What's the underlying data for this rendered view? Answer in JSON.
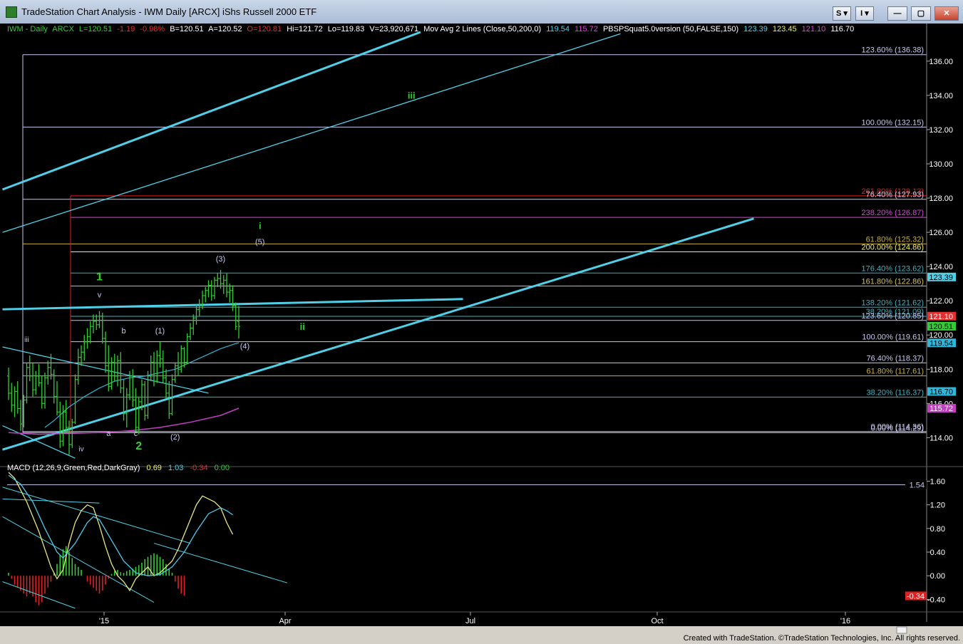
{
  "window": {
    "title": "TradeStation Chart Analysis - IWM Daily [ARCX] iShs Russell 2000 ETF",
    "btn_s": "S ▾",
    "btn_i": "I ▾"
  },
  "infobar": {
    "symbol": "IWM - Daily",
    "exchange": "ARCX",
    "last": "L=120.51",
    "change": "-1.19",
    "pct": "-0.98%",
    "bid": "B=120.51",
    "ask": "A=120.52",
    "open": "O=120.81",
    "high": "Hi=121.72",
    "low": "Lo=119.83",
    "volume": "V=23,920,671",
    "ma_label": "Mov Avg 2 Lines (Close,50,200,0)",
    "ma1": "119.54",
    "ma2": "115.72",
    "pbs_label": "PBSPSquat5.0version (50,FALSE,150)",
    "pbs1": "123.39",
    "pbs2": "123.45",
    "pbs3": "121.10",
    "pbs4": "116.70"
  },
  "macd_info": {
    "label": "MACD (12,26,9,Green,Red,DarkGray)",
    "v1": "0.69",
    "v2": "1.03",
    "v3": "-0.34",
    "v4": "0.00"
  },
  "status_text": "Created with TradeStation. ©TradeStation Technologies, Inc. All rights reserved.",
  "colors": {
    "bars": "#32cd32",
    "trend": "#4fd0e8",
    "ma_fast": "#2fb6d8",
    "ma_slow": "#c040c0",
    "macd_line": "#e8e880",
    "signal_line": "#4fc8e8",
    "hist_pos": "#32cd32",
    "hist_neg": "#e02020"
  },
  "chart_data": {
    "type": "candlestick",
    "price_axis": {
      "ylim": [
        112.6,
        137.7
      ],
      "ticks": [
        "114.00",
        "116.00",
        "118.00",
        "120.00",
        "122.00",
        "124.00",
        "126.00",
        "128.00",
        "130.00",
        "132.00",
        "134.00",
        "136.00"
      ]
    },
    "macd_axis": {
      "ylim": [
        -0.6,
        1.75
      ],
      "ticks": [
        "-0.40",
        "0.00",
        "0.40",
        "0.80",
        "1.20",
        "1.60"
      ]
    },
    "time_labels": [
      {
        "label": "'15",
        "x": 0
      },
      {
        "label": "Apr",
        "x": 76
      },
      {
        "label": "Jul",
        "x": 152
      },
      {
        "label": "Oct",
        "x": 230
      },
      {
        "label": "'16",
        "x": 307
      }
    ],
    "price_badges": [
      {
        "text": "123.39",
        "value": 123.39,
        "bg": "#4fd0e8",
        "fg": "#000000"
      },
      {
        "text": "121.10",
        "value": 121.1,
        "bg": "#e03030",
        "fg": "#ffffff"
      },
      {
        "text": "120.51",
        "value": 120.51,
        "bg": "#32cd32",
        "fg": "#000000"
      },
      {
        "text": "119.54",
        "value": 119.54,
        "bg": "#2fb6d8",
        "fg": "#000000"
      },
      {
        "text": "116.70",
        "value": 116.7,
        "bg": "#2fb6d8",
        "fg": "#000000"
      },
      {
        "text": "115.72",
        "value": 115.72,
        "bg": "#c040c0",
        "fg": "#ffffff"
      }
    ],
    "fib_levels": [
      {
        "label": "123.60% (136.38)",
        "value": 136.38,
        "color": "#c8c8f0"
      },
      {
        "label": "100.00% (132.15)",
        "value": 132.15,
        "color": "#c8c8f0"
      },
      {
        "label": "261.80% (128.13)",
        "value": 128.13,
        "color": "#e02020"
      },
      {
        "label": "76.40% (127.93)",
        "value": 127.93,
        "color": "#c8c8f0"
      },
      {
        "label": "238.20% (126.87)",
        "value": 126.87,
        "color": "#e040e0"
      },
      {
        "label": "61.80% (125.32)",
        "value": 125.32,
        "color": "#c8b040"
      },
      {
        "label": "200.00% (124.86)",
        "value": 124.86,
        "color": "#f0f060"
      },
      {
        "label": "176.40% (123.62)",
        "value": 123.62,
        "color": "#40b0c0"
      },
      {
        "label": "161.80% (122.86)",
        "value": 122.86,
        "color": "#d8c050"
      },
      {
        "label": "138.20% (121.62)",
        "value": 121.62,
        "color": "#40b0c0"
      },
      {
        "label": "38.20% (121.09)",
        "value": 121.09,
        "color": "#40b0c0"
      },
      {
        "label": "123.60% (120.85)",
        "value": 120.85,
        "color": "#c8c8f0"
      },
      {
        "label": "100.00% (119.61)",
        "value": 119.61,
        "color": "#c8c8f0"
      },
      {
        "label": "76.40% (118.37)",
        "value": 118.37,
        "color": "#c8c8f0"
      },
      {
        "label": "61.80% (117.61)",
        "value": 117.61,
        "color": "#c8b040"
      },
      {
        "label": "38.20% (116.37)",
        "value": 116.37,
        "color": "#40b0c0"
      },
      {
        "label": "0.00% (114.36)",
        "value": 114.36,
        "color": "#c8c8f0"
      },
      {
        "label": "0.00% (114.29)",
        "value": 114.29,
        "color": "#c8c8f0"
      }
    ],
    "wave_labels": [
      {
        "text": "iii",
        "value": 133.8,
        "bar": 133,
        "color": "#32cd32",
        "size": 13,
        "bold": true
      },
      {
        "text": "i",
        "value": 126.2,
        "bar": 83,
        "color": "#32cd32",
        "size": 13,
        "bold": true
      },
      {
        "text": "(5)",
        "value": 125.3,
        "bar": 83,
        "color": "#c8c8f0",
        "size": 11,
        "bold": false
      },
      {
        "text": "(3)",
        "value": 124.3,
        "bar": 70,
        "color": "#c8c8f0",
        "size": 11,
        "bold": false
      },
      {
        "text": "1",
        "value": 123.2,
        "bar": 30,
        "color": "#32cd32",
        "size": 16,
        "bold": true
      },
      {
        "text": "v",
        "value": 122.2,
        "bar": 30,
        "color": "#c8c8f0",
        "size": 11,
        "bold": false
      },
      {
        "text": "ii",
        "value": 120.3,
        "bar": 97,
        "color": "#32cd32",
        "size": 13,
        "bold": true
      },
      {
        "text": "b",
        "value": 120.1,
        "bar": 38,
        "color": "#c8c8f0",
        "size": 11,
        "bold": false
      },
      {
        "text": "(1)",
        "value": 120.1,
        "bar": 50,
        "color": "#c8c8f0",
        "size": 11,
        "bold": false
      },
      {
        "text": "iii",
        "value": 119.6,
        "bar": 6,
        "color": "#c8c8f0",
        "size": 10,
        "bold": false
      },
      {
        "text": "(4)",
        "value": 119.2,
        "bar": 78,
        "color": "#c8c8f0",
        "size": 11,
        "bold": false
      },
      {
        "text": "a",
        "value": 114.1,
        "bar": 33,
        "color": "#c8c8f0",
        "size": 11,
        "bold": false
      },
      {
        "text": "c",
        "value": 114.1,
        "bar": 42,
        "color": "#c8c8f0",
        "size": 11,
        "bold": false
      },
      {
        "text": "(2)",
        "value": 113.9,
        "bar": 55,
        "color": "#c8c8f0",
        "size": 11,
        "bold": false
      },
      {
        "text": "2",
        "value": 113.3,
        "bar": 43,
        "color": "#32cd32",
        "size": 16,
        "bold": true
      },
      {
        "text": "iv",
        "value": 113.2,
        "bar": 24,
        "color": "#c8c8f0",
        "size": 10,
        "bold": false
      }
    ],
    "macd_badges": [
      {
        "text": "1.54",
        "value": 1.54,
        "bg": "#000000",
        "fg": "#c8c8f0"
      },
      {
        "text": "-0.34",
        "value": -0.34,
        "bg": "#e02020",
        "fg": "#ffffff"
      }
    ],
    "ohlc": [
      [
        117.6,
        118.1,
        116.2,
        116.6
      ],
      [
        116.6,
        117.2,
        115.5,
        115.9
      ],
      [
        115.9,
        117.0,
        115.2,
        116.7
      ],
      [
        116.7,
        117.3,
        115.4,
        115.7
      ],
      [
        115.7,
        116.2,
        114.4,
        114.8
      ],
      [
        114.8,
        116.5,
        114.6,
        116.2
      ],
      [
        116.2,
        118.4,
        116.0,
        118.1
      ],
      [
        118.1,
        118.8,
        117.3,
        117.6
      ],
      [
        117.6,
        118.4,
        116.4,
        116.8
      ],
      [
        116.8,
        117.9,
        116.5,
        117.6
      ],
      [
        117.6,
        118.3,
        117.0,
        117.2
      ],
      [
        117.2,
        117.6,
        115.7,
        116.0
      ],
      [
        116.0,
        117.8,
        115.7,
        117.5
      ],
      [
        117.5,
        118.5,
        117.1,
        118.1
      ],
      [
        118.1,
        118.9,
        117.4,
        117.7
      ],
      [
        117.7,
        118.0,
        116.0,
        116.4
      ],
      [
        116.4,
        117.3,
        115.3,
        115.5
      ],
      [
        115.5,
        116.1,
        113.4,
        113.8
      ],
      [
        113.8,
        115.9,
        113.5,
        115.5
      ],
      [
        115.5,
        116.2,
        114.3,
        114.6
      ],
      [
        114.6,
        115.0,
        113.0,
        113.6
      ],
      [
        113.6,
        115.1,
        113.4,
        114.9
      ],
      [
        114.9,
        117.7,
        114.8,
        117.4
      ],
      [
        117.4,
        119.2,
        117.1,
        118.7
      ],
      [
        118.7,
        119.4,
        118.2,
        119.0
      ],
      [
        119.0,
        120.0,
        118.5,
        119.6
      ],
      [
        119.6,
        120.4,
        119.2,
        119.9
      ],
      [
        119.9,
        120.8,
        119.5,
        120.5
      ],
      [
        120.5,
        121.2,
        120.1,
        120.8
      ],
      [
        120.8,
        121.2,
        120.3,
        120.6
      ],
      [
        120.6,
        121.4,
        120.4,
        121.1
      ],
      [
        121.1,
        121.3,
        119.5,
        119.8
      ],
      [
        119.8,
        120.2,
        117.8,
        118.2
      ],
      [
        118.2,
        119.4,
        116.7,
        117.0
      ],
      [
        117.0,
        118.7,
        116.8,
        118.4
      ],
      [
        118.4,
        118.9,
        117.3,
        117.6
      ],
      [
        117.6,
        118.8,
        117.0,
        118.5
      ],
      [
        118.5,
        119.0,
        116.6,
        116.9
      ],
      [
        116.9,
        117.4,
        115.0,
        115.4
      ],
      [
        115.4,
        116.9,
        114.6,
        116.5
      ],
      [
        116.5,
        117.9,
        116.2,
        117.6
      ],
      [
        117.6,
        118.0,
        115.8,
        116.2
      ],
      [
        116.2,
        116.9,
        114.3,
        114.6
      ],
      [
        114.6,
        116.4,
        114.2,
        116.1
      ],
      [
        116.1,
        117.4,
        115.6,
        117.1
      ],
      [
        117.1,
        117.3,
        115.0,
        115.3
      ],
      [
        115.3,
        117.9,
        115.1,
        117.6
      ],
      [
        117.6,
        118.8,
        117.3,
        118.4
      ],
      [
        118.4,
        119.0,
        117.0,
        117.3
      ],
      [
        117.3,
        119.1,
        117.2,
        118.8
      ],
      [
        118.8,
        119.6,
        118.1,
        118.6
      ],
      [
        118.6,
        119.1,
        117.2,
        117.5
      ],
      [
        117.5,
        118.0,
        116.3,
        116.6
      ],
      [
        116.6,
        117.3,
        115.1,
        115.4
      ],
      [
        115.4,
        117.7,
        115.3,
        117.4
      ],
      [
        117.4,
        118.4,
        117.2,
        118.2
      ],
      [
        118.2,
        119.0,
        117.6,
        118.0
      ],
      [
        118.0,
        119.4,
        117.8,
        119.2
      ],
      [
        119.2,
        119.3,
        118.1,
        118.4
      ],
      [
        118.4,
        120.1,
        118.3,
        119.9
      ],
      [
        119.9,
        120.7,
        119.7,
        120.4
      ],
      [
        120.4,
        121.2,
        120.0,
        121.0
      ],
      [
        121.0,
        121.8,
        120.6,
        121.5
      ],
      [
        121.5,
        122.1,
        121.1,
        121.8
      ],
      [
        121.8,
        122.6,
        121.5,
        122.3
      ],
      [
        122.3,
        122.8,
        121.9,
        122.6
      ],
      [
        122.6,
        123.2,
        122.2,
        122.9
      ],
      [
        122.9,
        123.2,
        122.0,
        122.3
      ],
      [
        122.3,
        123.4,
        122.1,
        123.2
      ],
      [
        123.2,
        123.6,
        122.8,
        123.3
      ],
      [
        123.3,
        123.8,
        122.7,
        123.0
      ],
      [
        123.0,
        123.5,
        122.4,
        123.2
      ],
      [
        123.2,
        123.6,
        122.2,
        122.5
      ],
      [
        122.5,
        123.0,
        121.9,
        122.6
      ],
      [
        122.6,
        122.9,
        121.4,
        121.7
      ],
      [
        121.7,
        121.9,
        120.3,
        120.5
      ],
      [
        120.8,
        121.7,
        119.8,
        120.5
      ]
    ],
    "ma50": [
      [
        12,
        114.6
      ],
      [
        15,
        115.0
      ],
      [
        20,
        115.8
      ],
      [
        25,
        116.4
      ],
      [
        30,
        116.9
      ],
      [
        35,
        117.3
      ],
      [
        40,
        117.5
      ],
      [
        45,
        117.6
      ],
      [
        50,
        117.8
      ],
      [
        55,
        118.0
      ],
      [
        60,
        118.4
      ],
      [
        65,
        118.8
      ],
      [
        70,
        119.2
      ],
      [
        75,
        119.5
      ],
      [
        76,
        119.54
      ]
    ],
    "ma200": [
      [
        0,
        114.3
      ],
      [
        10,
        114.2
      ],
      [
        20,
        114.25
      ],
      [
        30,
        114.3
      ],
      [
        40,
        114.4
      ],
      [
        50,
        114.6
      ],
      [
        60,
        114.9
      ],
      [
        70,
        115.3
      ],
      [
        76,
        115.72
      ]
    ],
    "trendlines": [
      {
        "a": [
          -2,
          128.5
        ],
        "b": [
          136,
          137.7
        ],
        "w": 3
      },
      {
        "a": [
          -2,
          126.0
        ],
        "b": [
          202,
          137.6
        ],
        "w": 1.3
      },
      {
        "a": [
          -2,
          121.5
        ],
        "b": [
          150,
          122.1
        ],
        "w": 3
      },
      {
        "a": [
          -2,
          113.3
        ],
        "b": [
          246,
          126.8
        ],
        "w": 3
      },
      {
        "a": [
          -2,
          119.3
        ],
        "b": [
          66,
          116.6
        ],
        "w": 1.3
      },
      {
        "a": [
          -2,
          114.7
        ],
        "b": [
          22,
          112.8
        ],
        "w": 1.3
      }
    ],
    "macd_line": [
      [
        0,
        1.75
      ],
      [
        2,
        1.65
      ],
      [
        4,
        1.45
      ],
      [
        6,
        1.25
      ],
      [
        8,
        1.0
      ],
      [
        10,
        0.75
      ],
      [
        12,
        0.45
      ],
      [
        14,
        0.15
      ],
      [
        16,
        -0.05
      ],
      [
        18,
        0.1
      ],
      [
        20,
        0.55
      ],
      [
        22,
        0.9
      ],
      [
        24,
        1.1
      ],
      [
        26,
        1.2
      ],
      [
        28,
        1.15
      ],
      [
        30,
        0.85
      ],
      [
        32,
        0.5
      ],
      [
        34,
        0.2
      ],
      [
        36,
        0.0
      ],
      [
        38,
        -0.1
      ],
      [
        40,
        -0.25
      ],
      [
        42,
        -0.05
      ],
      [
        44,
        0.05
      ],
      [
        46,
        0.15
      ],
      [
        48,
        0.0
      ],
      [
        50,
        0.05
      ],
      [
        52,
        0.15
      ],
      [
        54,
        0.25
      ],
      [
        56,
        0.45
      ],
      [
        58,
        0.7
      ],
      [
        60,
        0.95
      ],
      [
        62,
        1.2
      ],
      [
        64,
        1.35
      ],
      [
        66,
        1.3
      ],
      [
        68,
        1.25
      ],
      [
        70,
        1.15
      ],
      [
        72,
        0.9
      ],
      [
        74,
        0.7
      ]
    ],
    "signal_line": [
      [
        0,
        1.7
      ],
      [
        4,
        1.55
      ],
      [
        8,
        1.25
      ],
      [
        12,
        0.8
      ],
      [
        16,
        0.4
      ],
      [
        18,
        0.3
      ],
      [
        22,
        0.55
      ],
      [
        26,
        0.9
      ],
      [
        28,
        1.0
      ],
      [
        30,
        0.95
      ],
      [
        34,
        0.6
      ],
      [
        38,
        0.25
      ],
      [
        42,
        0.05
      ],
      [
        46,
        0.0
      ],
      [
        50,
        0.02
      ],
      [
        54,
        0.15
      ],
      [
        58,
        0.4
      ],
      [
        62,
        0.75
      ],
      [
        66,
        1.05
      ],
      [
        70,
        1.15
      ],
      [
        72,
        1.1
      ],
      [
        74,
        1.03
      ]
    ],
    "histogram": [
      0.05,
      -0.05,
      -0.15,
      -0.2,
      -0.25,
      -0.3,
      -0.35,
      -0.3,
      -0.35,
      -0.45,
      -0.5,
      -0.45,
      -0.3,
      -0.2,
      -0.1,
      0.05,
      0.2,
      0.35,
      0.45,
      0.5,
      0.4,
      0.3,
      0.2,
      0.15,
      0.1,
      0.0,
      -0.1,
      -0.15,
      -0.2,
      -0.25,
      -0.3,
      -0.25,
      -0.15,
      -0.05,
      0.03,
      0.08,
      0.1,
      0.06,
      0.05,
      0.08,
      0.1,
      0.12,
      0.15,
      0.18,
      0.22,
      0.28,
      0.32,
      0.35,
      0.38,
      0.36,
      0.32,
      0.28,
      0.2,
      0.12,
      0.05,
      -0.1,
      -0.22,
      -0.3,
      -0.34
    ]
  }
}
